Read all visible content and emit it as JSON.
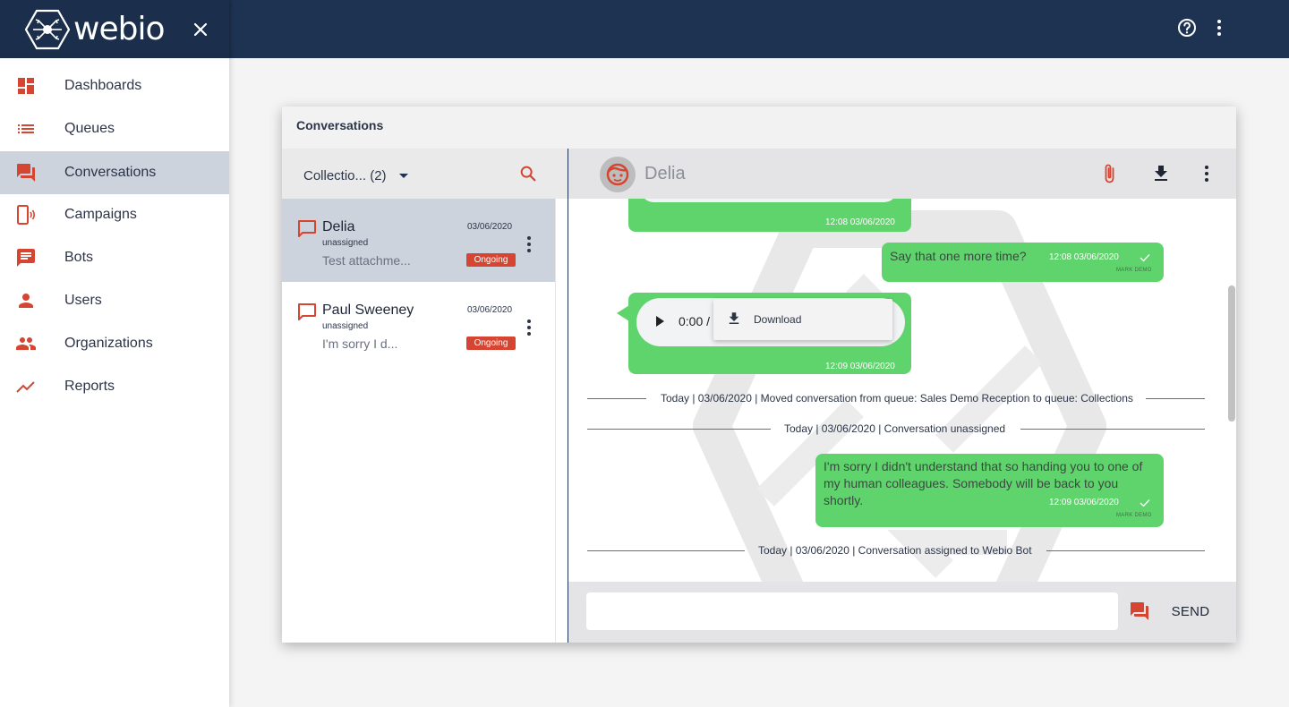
{
  "app": {
    "brand": "webio"
  },
  "header": {
    "close_icon": "close-icon",
    "help_icon": "help-circle-icon",
    "more_icon": "more-vertical-icon"
  },
  "sidebar": {
    "items": [
      {
        "label": "Dashboards",
        "icon": "dashboard-icon"
      },
      {
        "label": "Queues",
        "icon": "list-icon"
      },
      {
        "label": "Conversations",
        "icon": "forum-icon",
        "active": true
      },
      {
        "label": "Campaigns",
        "icon": "phone-ring-icon"
      },
      {
        "label": "Bots",
        "icon": "message-icon"
      },
      {
        "label": "Users",
        "icon": "person-icon"
      },
      {
        "label": "Organizations",
        "icon": "people-icon"
      },
      {
        "label": "Reports",
        "icon": "trending-up-icon"
      }
    ]
  },
  "card": {
    "title": "Conversations"
  },
  "list": {
    "queue_select": "Collectio... (2)",
    "search_icon": "search-icon",
    "conversations": [
      {
        "name": "Delia",
        "assignee": "unassigned",
        "preview": "Test attachme...",
        "date": "03/06/2020",
        "status": "Ongoing",
        "active": true
      },
      {
        "name": "Paul Sweeney",
        "assignee": "unassigned",
        "preview": "I'm sorry I d...",
        "date": "03/06/2020",
        "status": "Ongoing",
        "active": false
      }
    ]
  },
  "chat": {
    "contact_name": "Delia",
    "messages": [
      {
        "time": "12:08 03/06/2020"
      },
      {
        "text": "Say that one more time?",
        "time": "12:08 03/06/2020",
        "author": "MARK DEMO"
      },
      {
        "time": "12:09 03/06/2020"
      },
      {
        "text": "I'm sorry I didn't understand that so handing you to one of my human colleagues. Somebody will be back to you shortly.",
        "time": "12:09 03/06/2020",
        "author": "MARK DEMO"
      }
    ],
    "audio": {
      "time": "0:00 /",
      "menu_label": "Download"
    },
    "events": [
      "Today | 03/06/2020 | Moved conversation from queue: Sales Demo Reception to queue: Collections",
      "Today | 03/06/2020 | Conversation unassigned",
      "Today | 03/06/2020 | Conversation assigned to Webio Bot"
    ],
    "compose": {
      "placeholder": "",
      "send_label": "SEND"
    }
  },
  "colors": {
    "navy": "#1e3352",
    "accent_red": "#d64531",
    "bubble_green": "#5fd46c",
    "active_row": "#cdd3dd"
  }
}
